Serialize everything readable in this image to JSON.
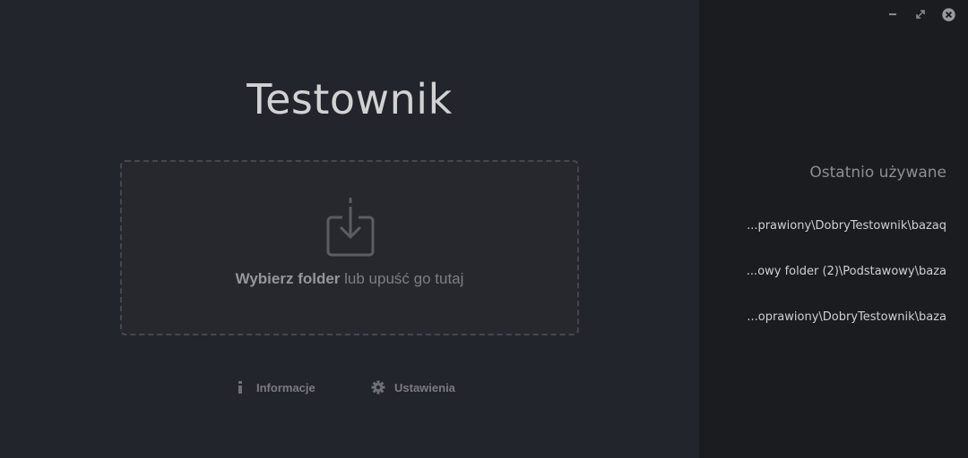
{
  "app": {
    "title": "Testownik"
  },
  "dropzone": {
    "icon": "download-tray-icon",
    "choose_label": "Wybierz folder",
    "drop_label": " lub upuść go tutaj"
  },
  "footer": {
    "info": {
      "icon": "info-icon",
      "label": "Informacje"
    },
    "settings": {
      "icon": "gear-icon",
      "label": "Ustawienia"
    }
  },
  "window_controls": {
    "minimize_icon": "minimize-icon",
    "restore_icon": "restore-icon",
    "close_icon": "close-icon"
  },
  "sidebar": {
    "title": "Ostatnio używane",
    "recent": [
      "...prawiony\\DobryTestownik\\bazaq",
      "...owy folder (2)\\Podstawowy\\baza",
      "...oprawiony\\DobryTestownik\\baza"
    ]
  },
  "colors": {
    "main_bg": "#23252c",
    "sidebar_bg": "#1b1c20",
    "dropzone_border": "#464850",
    "title_text": "#d2d2d4"
  }
}
